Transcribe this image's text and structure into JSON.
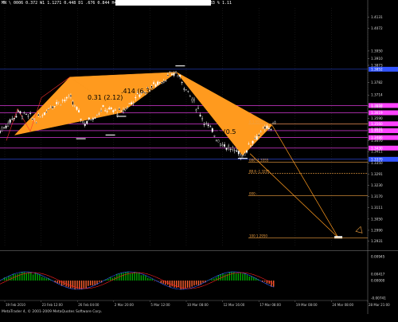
{
  "header": {
    "info_line": "MN \\ 0006    0.372    W1 1.1271    0.448    D1 .676    0.844    H4 1.469    0.864    H1 2.568    0.138    M30 .1.4    2.83 %   1.11",
    "banner": ""
  },
  "macd": {
    "title": "MACD (EMA(12),EMA(26),EMA(9))  0.0014992  0.0002898  0.0013878  -0.0001083"
  },
  "footer": {
    "copyright": "MetaTrader 4, © 2001-2009 MetaQuotes Software Corp."
  },
  "pattern_labels": {
    "label_a": "0.31 (2.12)",
    "label_b": ".414 (6.36)",
    "label_c": "5 (0.5"
  },
  "fib_levels": [
    {
      "label": "0.1.5552",
      "price": 1.356
    },
    {
      "label": "080 -1.3355",
      "price": 1.3355
    },
    {
      "label": "88.6 -1.3295",
      "price": 1.3295
    },
    {
      "label": "000 -",
      "price": 1.3175
    },
    {
      "label": "100 1.2950",
      "price": 1.295
    }
  ],
  "chart_data": {
    "type": "candlestick",
    "symbol": "",
    "x_ticks": [
      "19 Feb 2010",
      "23 Feb 12:00",
      "26 Feb 04:00",
      "2 Mar 20:00",
      "5 Mar 12:00",
      "10 Mar 08:00",
      "12 Mar 16:00",
      "17 Mar 08:00",
      "19 Mar 08:00",
      "24 Mar 08:00",
      "28 Mar 21:00"
    ],
    "y_ticks": [
      "1.4131",
      "1.4072",
      "1.3950",
      "1.3910",
      "1.3873",
      "1.3782",
      "1.3714",
      "1.3652",
      "1.3590",
      "1.3531",
      "1.3470",
      "1.3411",
      "1.3350",
      "1.3291",
      "1.3230",
      "1.3170",
      "1.3111",
      "1.3050",
      "1.2990",
      "1.2931"
    ],
    "ylim": [
      1.29,
      1.418
    ],
    "highlighted_prices": [
      {
        "value": "1.3852",
        "color": "#3355ff"
      },
      {
        "value": "1.3658",
        "color": "#ff44ff"
      },
      {
        "value": "1.3619",
        "color": "#ff44ff"
      },
      {
        "value": "1.3560",
        "color": "#ff44ff"
      },
      {
        "value": "1.3523",
        "color": "#ff44ff"
      },
      {
        "value": "1.3486",
        "color": "#ff44ff"
      },
      {
        "value": "1.3430",
        "color": "#ff44ff"
      },
      {
        "value": "1.3370",
        "color": "#3355ff"
      }
    ],
    "pattern_points": [
      {
        "name": "X",
        "x": 8,
        "y": 1.35
      },
      {
        "name": "A",
        "x": 38,
        "y": 1.381
      },
      {
        "name": "B",
        "x": 66,
        "y": 1.362
      },
      {
        "name": "C",
        "x": 96,
        "y": 1.3836
      },
      {
        "name": "D",
        "x": 132,
        "y": 1.339
      },
      {
        "name": "E",
        "x": 148,
        "y": 1.3552
      },
      {
        "name": "F",
        "x": 184,
        "y": 1.295
      }
    ]
  }
}
